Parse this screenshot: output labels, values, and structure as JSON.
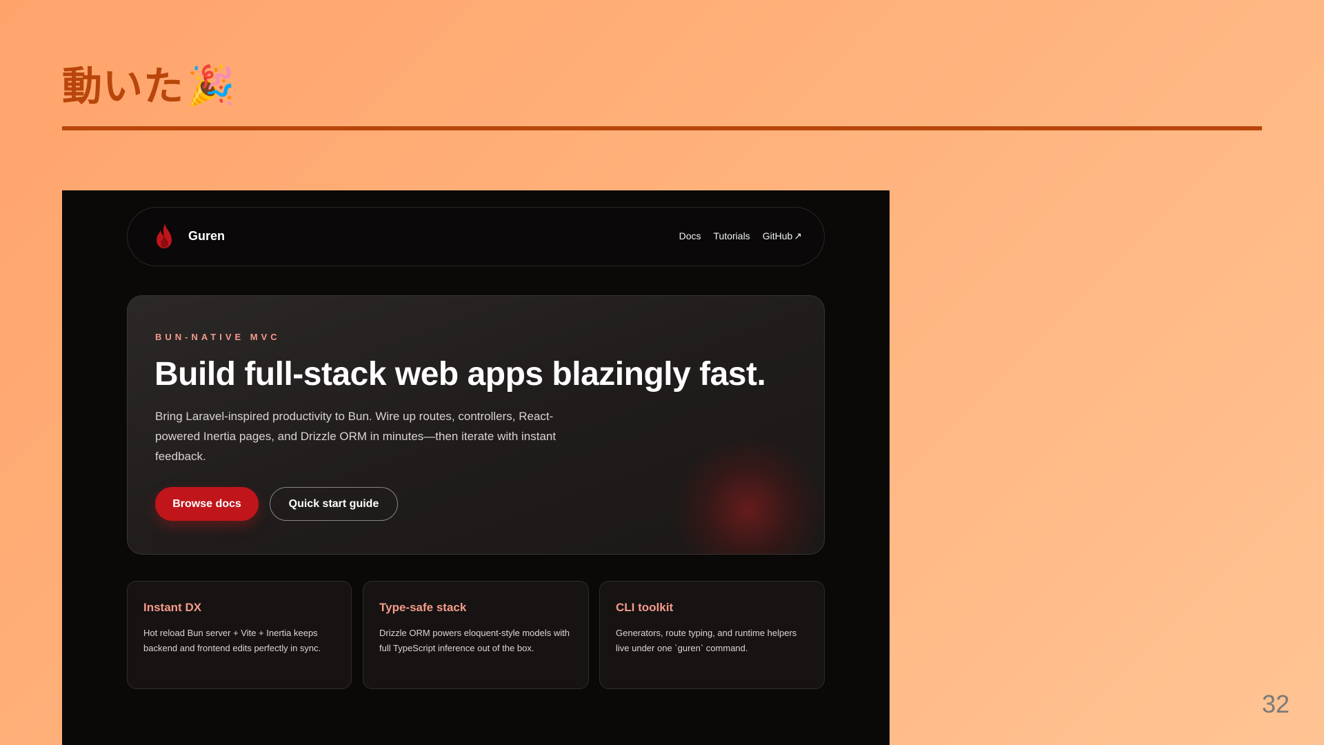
{
  "slide": {
    "title": "動いた",
    "title_emoji": "🎉",
    "page_number": "32"
  },
  "app": {
    "brand": {
      "name": "Guren",
      "icon": "flame-icon",
      "accent": "#c0161b"
    },
    "nav": {
      "links": [
        {
          "label": "Docs"
        },
        {
          "label": "Tutorials"
        },
        {
          "label": "GitHub",
          "suffix": "↗"
        }
      ]
    },
    "hero": {
      "eyebrow": "BUN-NATIVE MVC",
      "heading": "Build full-stack web apps blazingly fast.",
      "body": "Bring Laravel-inspired productivity to Bun. Wire up routes, controllers, React-powered Inertia pages, and Drizzle ORM in minutes—then iterate with instant feedback.",
      "primary_button": "Browse docs",
      "secondary_button": "Quick start guide"
    },
    "features": [
      {
        "title": "Instant DX",
        "body": "Hot reload Bun server + Vite + Inertia keeps backend and frontend edits perfectly in sync."
      },
      {
        "title": "Type-safe stack",
        "body": "Drizzle ORM powers eloquent-style models with full TypeScript inference out of the box."
      },
      {
        "title": "CLI toolkit",
        "body": "Generators, route typing, and runtime helpers live under one `guren` command."
      }
    ]
  },
  "colors": {
    "slide_accent": "#b8460b",
    "eyebrow": "#f39a8c",
    "feature_title": "#f59b8b",
    "app_background": "#0b0908"
  }
}
